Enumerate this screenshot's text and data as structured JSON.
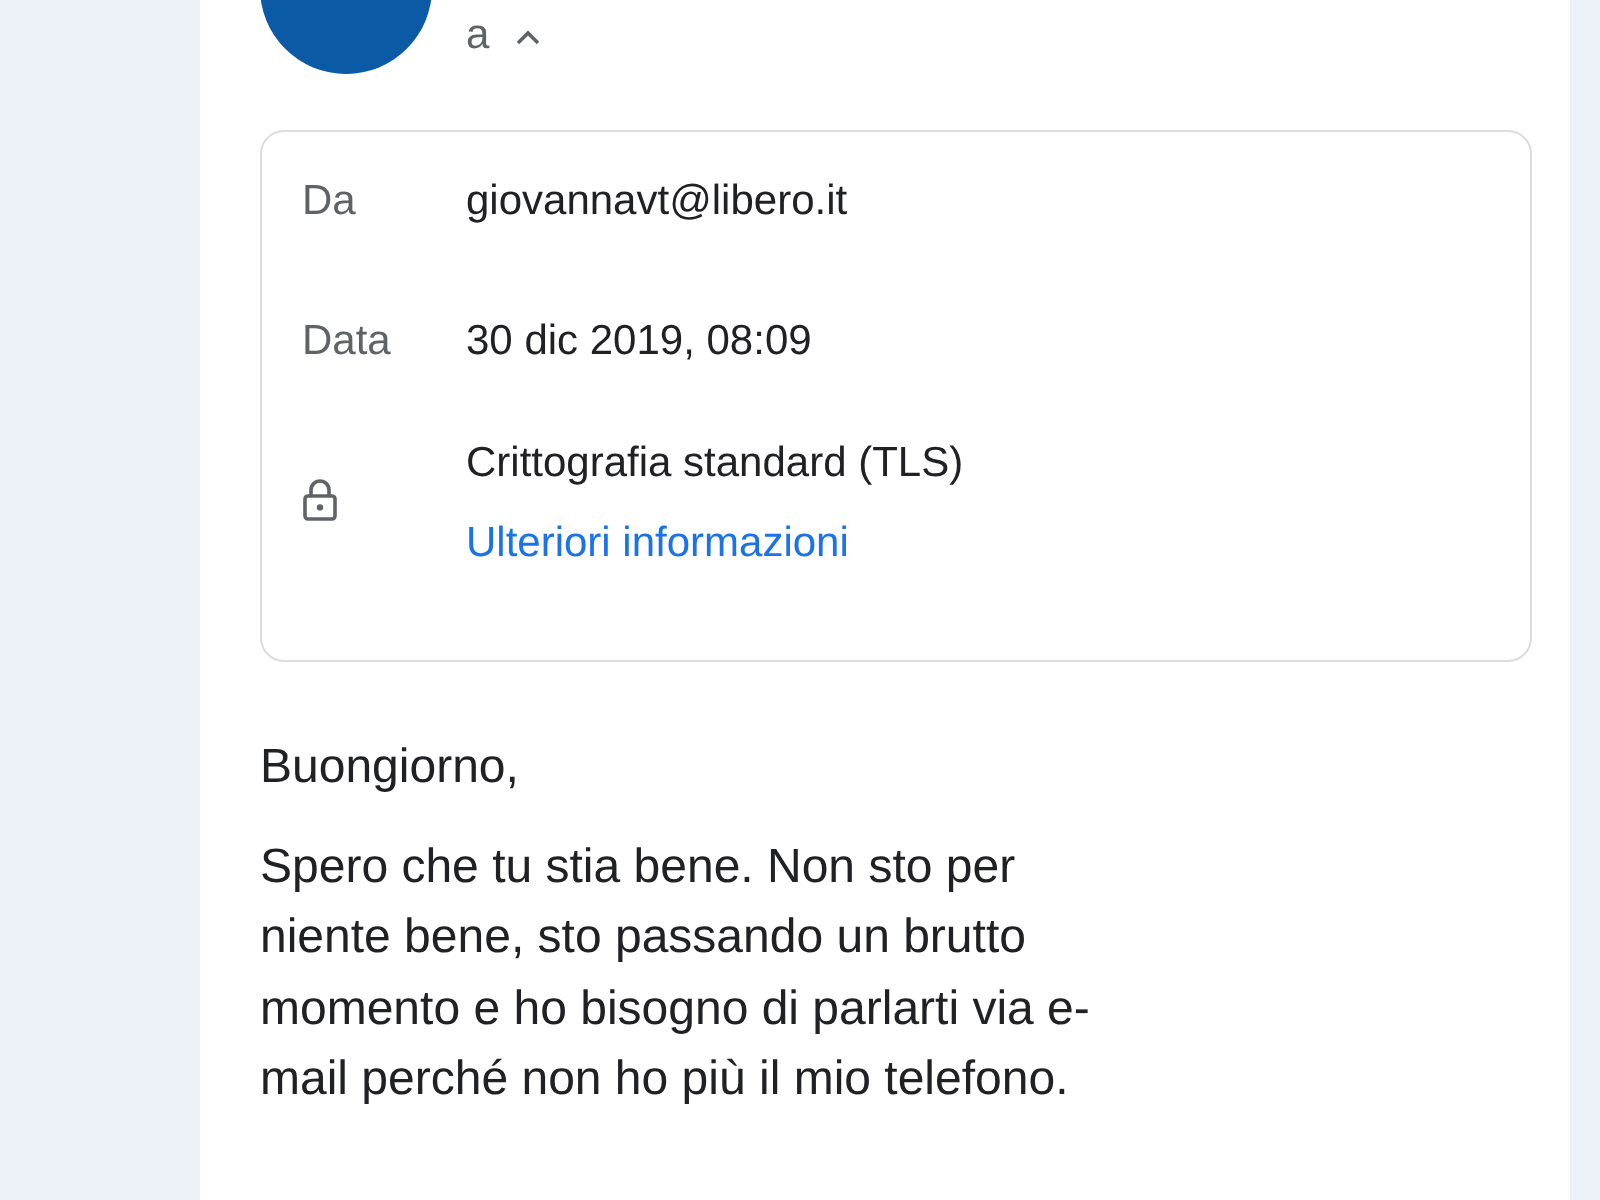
{
  "sender": {
    "recipient_label": "a"
  },
  "details": {
    "rows": [
      {
        "label": "Da",
        "value": "giovannavt@libero.it"
      },
      {
        "label": "Data",
        "value": "30 dic 2019, 08:09"
      }
    ],
    "encryption": {
      "title": "Crittografia standard (TLS)",
      "link": "Ulteriori informazioni"
    }
  },
  "body": {
    "greeting": "Buongiorno,",
    "lines": [
      "Spero che tu stia bene. Non sto per",
      "niente bene, sto passando un brutto",
      "momento e ho bisogno di parlarti via e-",
      "mail perché non ho più il mio telefono."
    ]
  }
}
